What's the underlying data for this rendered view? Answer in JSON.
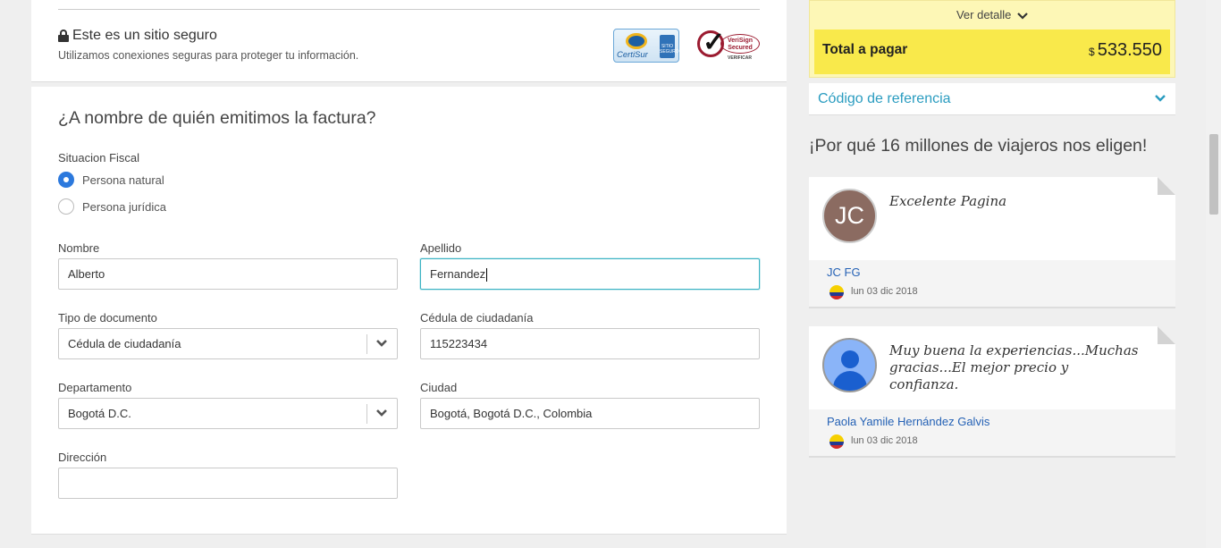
{
  "secure": {
    "title": "Este es un sitio seguro",
    "subtitle": "Utilizamos conexiones seguras para proteger tu información.",
    "certisur_label": "CertiSur",
    "certisur_badge": "SITIO SEGURO",
    "verisign_label": "VeriSign Secured",
    "verisign_small": "VERIFICAR"
  },
  "form": {
    "title": "¿A nombre de quién emitimos la factura?",
    "fiscal_label": "Situacion Fiscal",
    "radio_options": [
      "Persona natural",
      "Persona jurídica"
    ],
    "selected_radio": "Persona natural",
    "nombre_label": "Nombre",
    "nombre_value": "Alberto",
    "apellido_label": "Apellido",
    "apellido_value": "Fernandez",
    "tipo_doc_label": "Tipo de documento",
    "tipo_doc_value": "Cédula de ciudadanía",
    "cedula_label": "Cédula de ciudadanía",
    "cedula_value": "115223434",
    "departamento_label": "Departamento",
    "departamento_value": "Bogotá D.C.",
    "ciudad_label": "Ciudad",
    "ciudad_value": "Bogotá, Bogotá D.C., Colombia",
    "direccion_label": "Dirección",
    "direccion_value": ""
  },
  "summary": {
    "ver_detalle": "Ver detalle",
    "total_label": "Total a pagar",
    "currency": "$",
    "total_value": "533.550",
    "reference_label": "Código de referencia"
  },
  "reviews": {
    "title": "¡Por qué 16 millones de viajeros nos eligen!",
    "items": [
      {
        "initials": "JC",
        "text": "Excelente Pagina",
        "name": "JC FG",
        "date": "lun 03 dic 2018"
      },
      {
        "initials": "",
        "text": "Muy buena la experiencias...Muchas gracias...El mejor precio y confianza.",
        "name": "Paola Yamile Hernández Galvis",
        "date": "lun 03 dic 2018"
      }
    ]
  },
  "colors": {
    "accent_blue": "#2c79dd",
    "link_teal": "#2a9cc0",
    "total_yellow": "#f9e94b",
    "summary_bg": "#fdf7b6"
  }
}
